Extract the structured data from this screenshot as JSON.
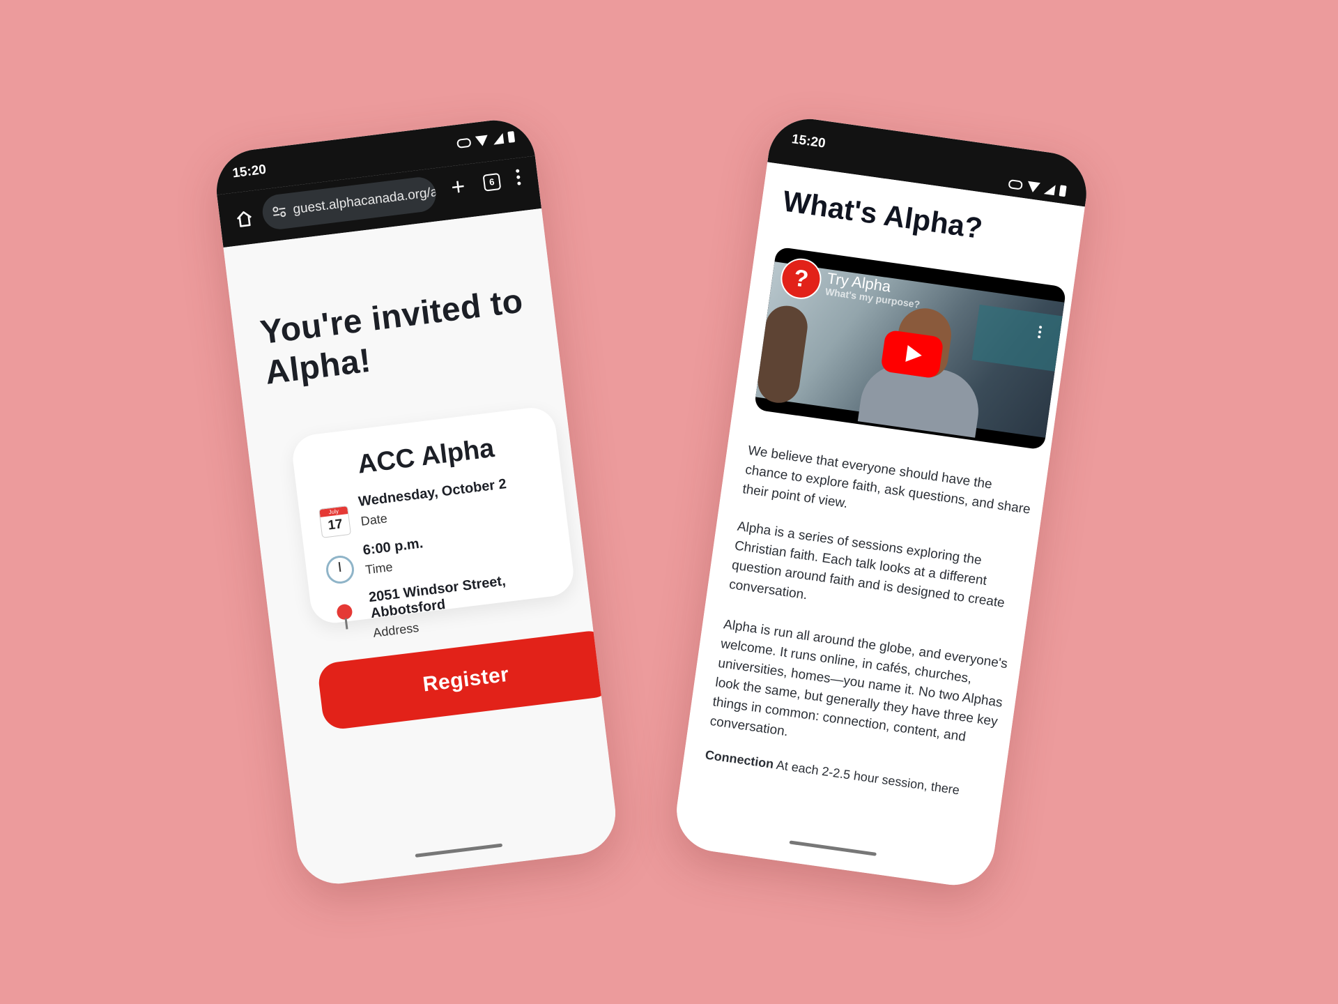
{
  "left_phone": {
    "status": {
      "time": "15:20"
    },
    "browser": {
      "url": "guest.alphacanada.org/a",
      "tab_count": "6",
      "new_tab_symbol": "+"
    },
    "page": {
      "title": "You're invited to Alpha!",
      "card": {
        "event_name": "ACC Alpha",
        "calendar_icon": {
          "month": "July",
          "day": "17"
        },
        "rows": [
          {
            "icon": "calendar-icon",
            "value": "Wednesday, October 2",
            "label": "Date"
          },
          {
            "icon": "clock-icon",
            "value": "6:00 p.m.",
            "label": "Time"
          },
          {
            "icon": "pin-icon",
            "value": "2051 Windsor Street, Abbotsford",
            "label": "Address"
          }
        ]
      },
      "register_label": "Register"
    }
  },
  "right_phone": {
    "status": {
      "time": "15:20"
    },
    "page": {
      "title": "What's Alpha?",
      "video": {
        "logo_symbol": "?",
        "title": "Try Alpha",
        "subtitle": "What's my purpose?"
      },
      "paragraphs": [
        "We believe that everyone should have the chance to explore faith, ask questions, and share their point of view.",
        "Alpha is a series of sessions exploring the Christian faith. Each talk looks at a different question around faith and is designed to create conversation.",
        "Alpha is run all around the globe, and everyone's welcome. It runs online, in cafés, churches, universities, homes—you name it. No two Alphas look the same, but generally they have three key things in common: connection, content, and conversation."
      ],
      "partial_paragraph": {
        "heading": "Connection",
        "text": "At each 2-2.5 hour session, there"
      }
    }
  },
  "colors": {
    "background": "#ec9b9c",
    "accent_red": "#e22219",
    "status_bar": "#121212"
  }
}
